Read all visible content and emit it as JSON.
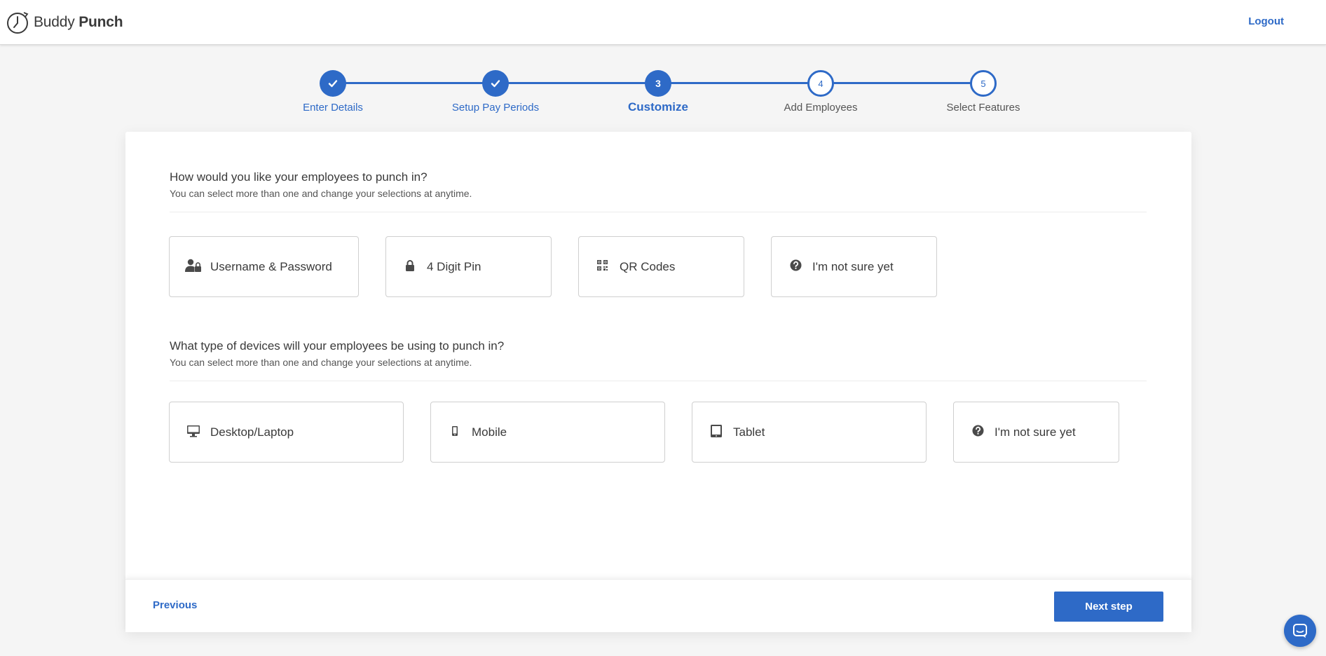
{
  "header": {
    "logo_word1": "Buddy",
    "logo_word2": "Punch",
    "logout_label": "Logout"
  },
  "stepper": {
    "steps": [
      {
        "number": "1",
        "label": "Enter Details",
        "state": "done"
      },
      {
        "number": "2",
        "label": "Setup Pay Periods",
        "state": "done"
      },
      {
        "number": "3",
        "label": "Customize",
        "state": "current"
      },
      {
        "number": "4",
        "label": "Add Employees",
        "state": "todo"
      },
      {
        "number": "5",
        "label": "Select Features",
        "state": "todo"
      }
    ]
  },
  "punch_methods": {
    "title": "How would you like your employees to punch in?",
    "subtitle": "You can select more than one and change your selections at anytime.",
    "options": [
      {
        "label": "Username & Password",
        "icon": "user-lock-icon"
      },
      {
        "label": "4 Digit Pin",
        "icon": "lock-icon"
      },
      {
        "label": "QR Codes",
        "icon": "qr-code-icon"
      },
      {
        "label": "I'm not sure yet",
        "icon": "question-circle-icon"
      }
    ]
  },
  "devices": {
    "title": "What type of devices will your employees be using to punch in?",
    "subtitle": "You can select more than one and change your selections at anytime.",
    "options": [
      {
        "label": "Desktop/Laptop",
        "icon": "desktop-icon"
      },
      {
        "label": "Mobile",
        "icon": "mobile-icon"
      },
      {
        "label": "Tablet",
        "icon": "tablet-icon"
      },
      {
        "label": "I'm not sure yet",
        "icon": "question-circle-icon"
      }
    ]
  },
  "footer": {
    "previous_label": "Previous",
    "next_label": "Next step"
  },
  "colors": {
    "accent": "#2e6ac7",
    "text": "#3a3a3a",
    "border": "#cfcfcf",
    "background": "#f5f5f5"
  }
}
